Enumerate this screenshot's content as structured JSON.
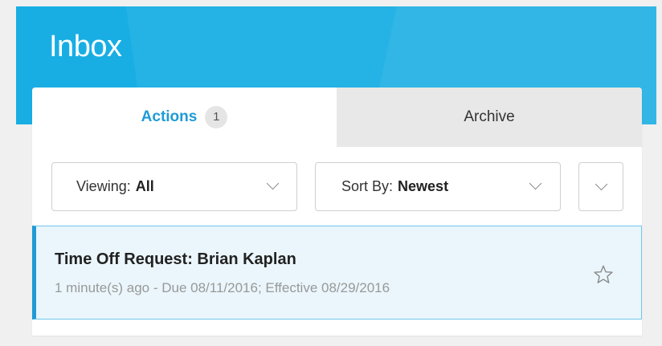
{
  "header": {
    "title": "Inbox",
    "color": "#18aee4"
  },
  "tabs": {
    "actions_label": "Actions",
    "actions_count": "1",
    "archive_label": "Archive",
    "active": "Actions"
  },
  "filters": {
    "viewing_label": "Viewing:",
    "viewing_value": "All",
    "sort_label": "Sort By:",
    "sort_value": "Newest",
    "more_icon": "chevron-down-icon"
  },
  "inbox_items": [
    {
      "title": "Time Off Request: Brian Kaplan",
      "meta": "1 minute(s) ago - Due 08/11/2016; Effective 08/29/2016",
      "starred": false,
      "selected": true
    }
  ],
  "colors": {
    "accent": "#1f9bd6",
    "selected_bg": "#eaf6fb"
  }
}
